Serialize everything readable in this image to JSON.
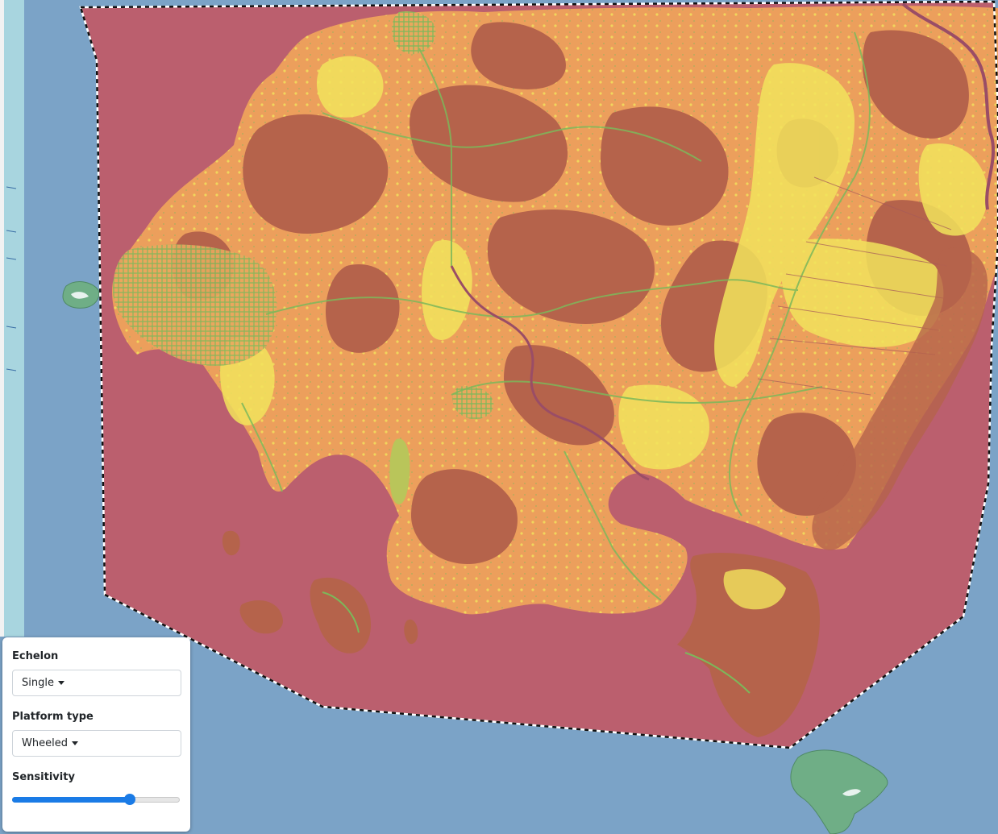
{
  "map": {
    "water_color": "#7ba3c7",
    "aoi_fill_color": "#bb5f6e",
    "land_colors": {
      "very_low": "#b5634b",
      "low": "#ec9f5c",
      "medium": "#f2e35c",
      "roads_urban": "#7cb85a",
      "islands_outside": "#6fae86"
    }
  },
  "controls": {
    "echelon": {
      "label": "Echelon",
      "value": "Single"
    },
    "platform_type": {
      "label": "Platform type",
      "value": "Wheeled"
    },
    "sensitivity": {
      "label": "Sensitivity",
      "value_fraction": 0.7
    }
  }
}
